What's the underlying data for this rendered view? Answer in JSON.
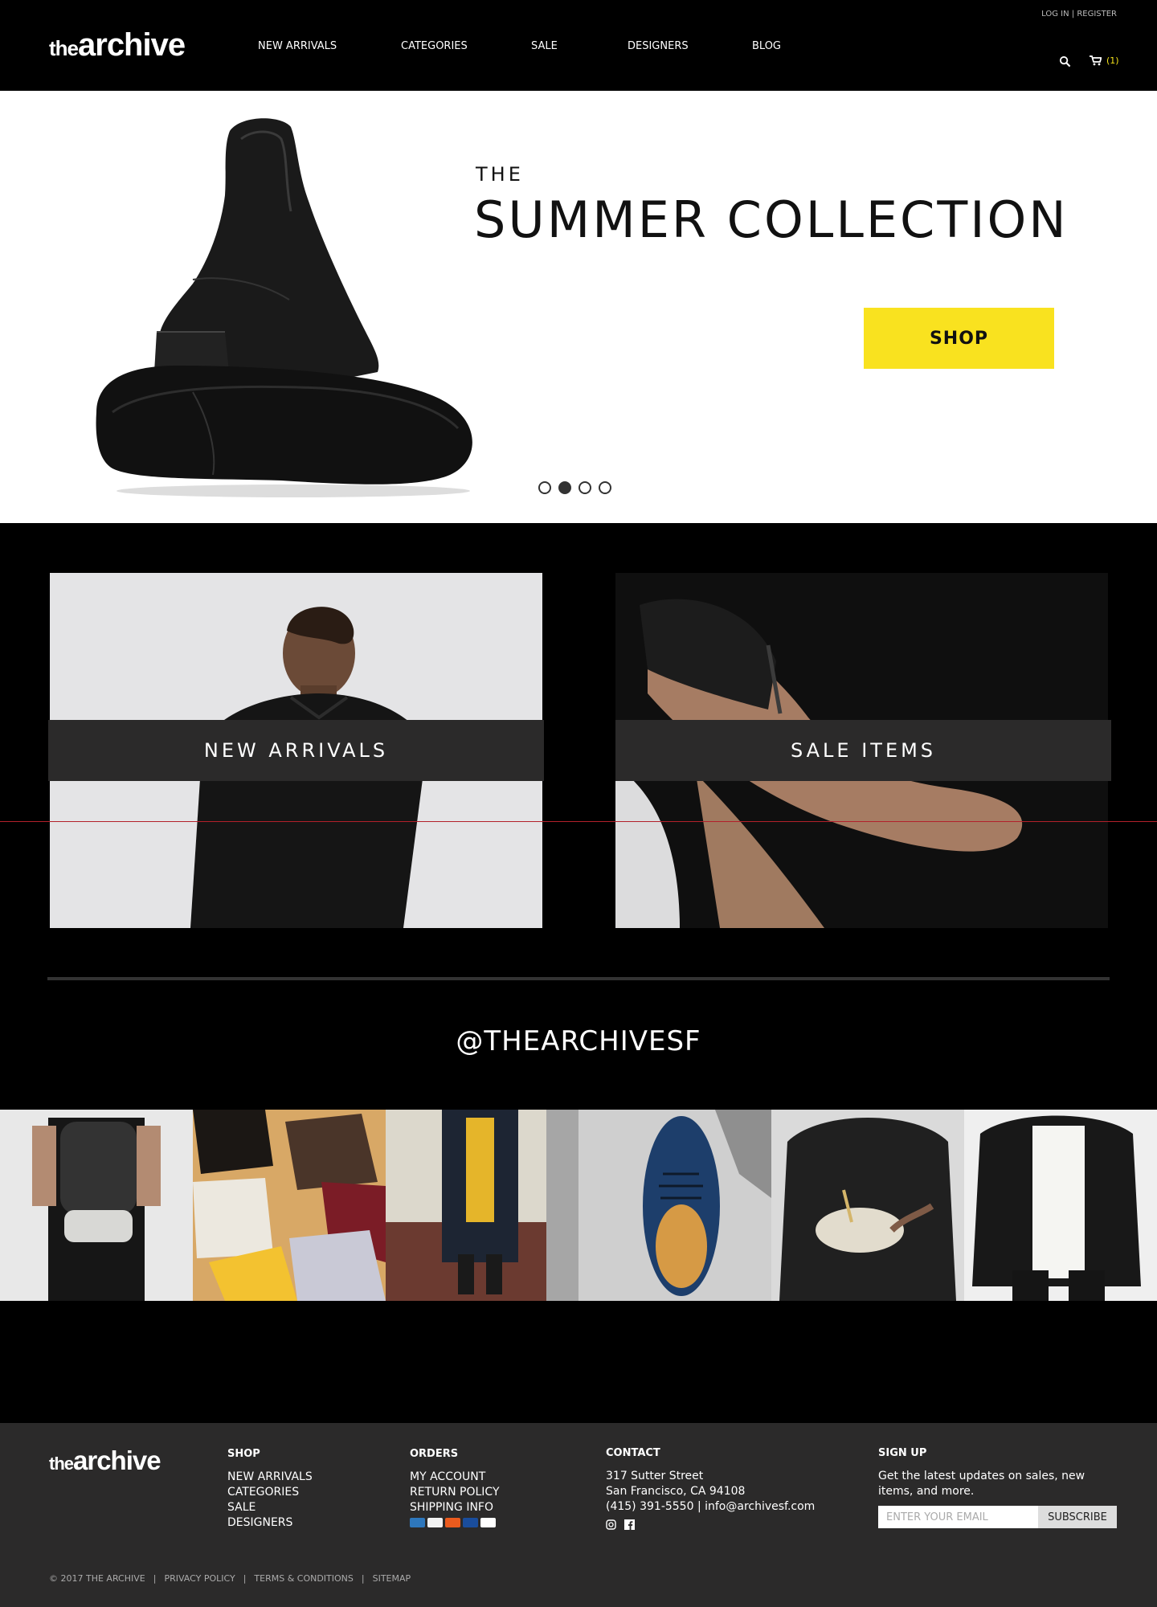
{
  "header": {
    "logo_the": "the",
    "logo_archive": "archive",
    "nav": [
      {
        "label": "NEW ARRIVALS"
      },
      {
        "label": "CATEGORIES"
      },
      {
        "label": "SALE"
      },
      {
        "label": "DESIGNERS"
      },
      {
        "label": "BLOG"
      }
    ],
    "login": "LOG IN",
    "separator": "|",
    "register": "REGISTER",
    "cart_count": "(1)"
  },
  "hero": {
    "kicker": "THE",
    "title": "SUMMER COLLECTION",
    "cta": "SHOP",
    "slides": 4,
    "active_slide": 2
  },
  "promos": [
    {
      "label": "NEW ARRIVALS"
    },
    {
      "label": "SALE ITEMS"
    }
  ],
  "instagram": {
    "handle": "@THEARCHIVESF"
  },
  "footer": {
    "logo_the": "the",
    "logo_archive": "archive",
    "shop": {
      "heading": "SHOP",
      "links": [
        "NEW ARRIVALS",
        "CATEGORIES",
        "SALE",
        "DESIGNERS"
      ]
    },
    "orders": {
      "heading": "ORDERS",
      "links": [
        "MY ACCOUNT",
        "RETURN POLICY",
        "SHIPPING INFO"
      ]
    },
    "contact": {
      "heading": "CONTACT",
      "address1": "317 Sutter Street",
      "address2": "San Francisco, CA 94108",
      "phone_email": "(415) 391-5550 | info@archivesf.com"
    },
    "signup": {
      "heading": "SIGN UP",
      "text": "Get the latest updates on sales, new items, and more.",
      "placeholder": "ENTER YOUR EMAIL",
      "button": "SUBSCRIBE"
    },
    "bottom": {
      "copyright": "© 2017 THE ARCHIVE",
      "sep": "|",
      "links": [
        "PRIVACY POLICY",
        "TERMS & CONDITIONS",
        "SITEMAP"
      ]
    }
  },
  "colors": {
    "accent_yellow": "#f9e21f",
    "band_gray": "#2b2a2a",
    "background": "#000000"
  }
}
